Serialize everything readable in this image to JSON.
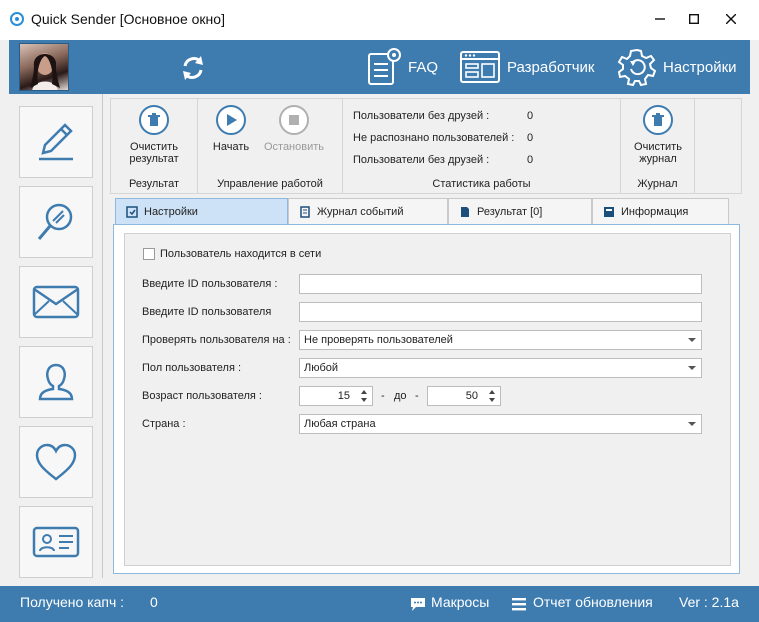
{
  "window": {
    "title": "Quick Sender [Основное окно]"
  },
  "topbar": {
    "faq_label": "FAQ",
    "developer_label": "Разработчик",
    "settings_label": "Настройки"
  },
  "ribbon": {
    "result_group": {
      "clear_label_1": "Очистить",
      "clear_label_2": "результат",
      "group_label": "Результат"
    },
    "control_group": {
      "start_label": "Начать",
      "stop_label": "Остановить",
      "group_label": "Управление работой"
    },
    "stats_group": {
      "rows": [
        {
          "label": "Пользователи без друзей :",
          "value": "0"
        },
        {
          "label": "Не распознано пользователей :",
          "value": "0"
        },
        {
          "label": "Пользователи без друзей :",
          "value": "0"
        }
      ],
      "group_label": "Статистика работы"
    },
    "journal_group": {
      "clear_label_1": "Очистить",
      "clear_label_2": "журнал",
      "group_label": "Журнал"
    }
  },
  "tabs": [
    {
      "label": "Настройки",
      "active": true
    },
    {
      "label": "Журнал событий",
      "active": false
    },
    {
      "label": "Результат [0]",
      "active": false
    },
    {
      "label": "Информация",
      "active": false
    }
  ],
  "form": {
    "online_checkbox_label": "Пользователь находится в сети",
    "online_checked": false,
    "user_id_label_1": "Введите ID пользователя :",
    "user_id_value_1": "",
    "user_id_label_2": "Введите ID пользователя",
    "user_id_value_2": "",
    "check_label": "Проверять пользователя на :",
    "check_value": "Не проверять пользователей",
    "gender_label": "Пол пользователя :",
    "gender_value": "Любой",
    "age_label": "Возраст пользователя :",
    "age_from": "15",
    "age_dash": "-",
    "age_to_label": "до",
    "age_dash_2": "-",
    "age_to": "50",
    "country_label": "Страна :",
    "country_value": "Любая страна"
  },
  "statusbar": {
    "captcha_label": "Получено капч :",
    "captcha_value": "0",
    "macros_label": "Макросы",
    "update_label": "Отчет обновления",
    "version_label": "Ver : 2.1a"
  },
  "colors": {
    "accent": "#3e7cb0",
    "tab_active": "#cde2f7"
  }
}
